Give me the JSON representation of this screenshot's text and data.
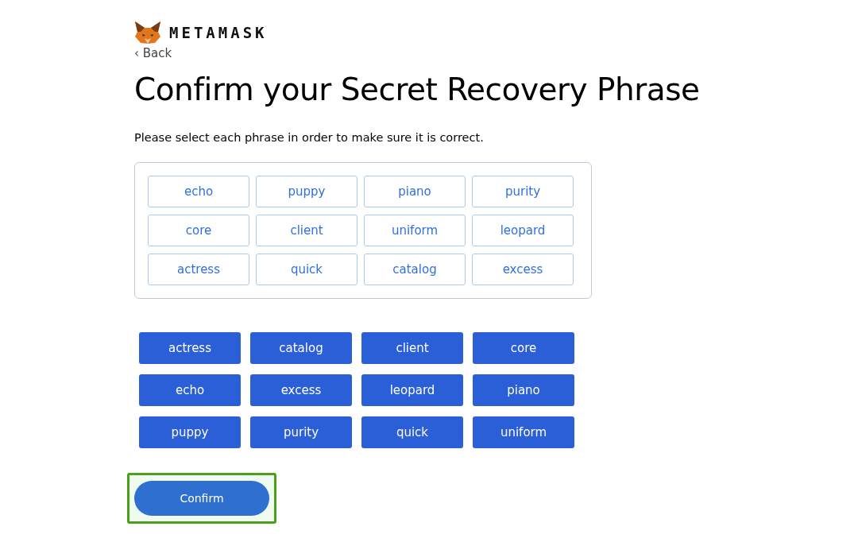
{
  "brand": {
    "name": "METAMASK"
  },
  "back_link": "‹ Back",
  "title": "Confirm your Secret Recovery Phrase",
  "instruction": "Please select each phrase in order to make sure it is correct.",
  "selected_words": [
    "echo",
    "puppy",
    "piano",
    "purity",
    "core",
    "client",
    "uniform",
    "leopard",
    "actress",
    "quick",
    "catalog",
    "excess"
  ],
  "word_options": [
    "actress",
    "catalog",
    "client",
    "core",
    "echo",
    "excess",
    "leopard",
    "piano",
    "puppy",
    "purity",
    "quick",
    "uniform"
  ],
  "confirm_button": {
    "label": "Confirm",
    "highlighted": true
  }
}
